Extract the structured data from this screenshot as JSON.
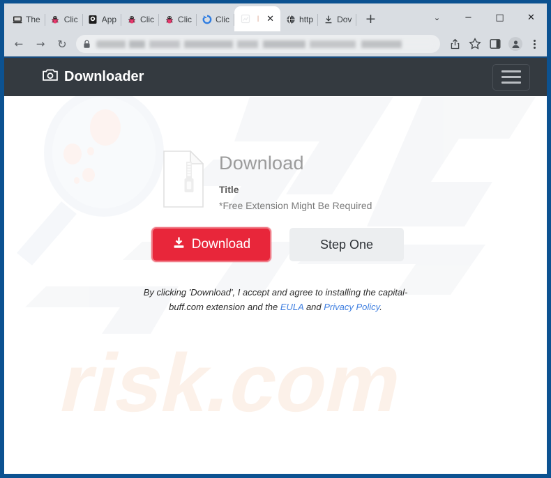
{
  "browser": {
    "tabs": [
      {
        "label": "The",
        "icon": "computer-icon",
        "active": false
      },
      {
        "label": "Clic",
        "icon": "bug-icon",
        "active": false
      },
      {
        "label": "App",
        "icon": "monitor-icon",
        "active": false
      },
      {
        "label": "Clic",
        "icon": "bug-icon",
        "active": false
      },
      {
        "label": "Clic",
        "icon": "bug-icon",
        "active": false
      },
      {
        "label": "Clic",
        "icon": "refresh-icon",
        "active": false
      },
      {
        "label": "I",
        "icon": "blank-page-icon",
        "active": true
      },
      {
        "label": "http",
        "icon": "globe-icon",
        "active": false
      },
      {
        "label": "Dov",
        "icon": "download-icon",
        "active": false
      }
    ],
    "new_tab_label": "+",
    "tab_close_label": "✕",
    "window_controls": {
      "tab_search": "⌄",
      "minimize": "−",
      "maximize": "□",
      "close": "✕"
    },
    "nav": {
      "back": "←",
      "forward": "→",
      "reload": "↻"
    },
    "omnibox": {
      "value": "",
      "placeholder": "",
      "security_icon": "lock-icon"
    },
    "toolbar_icons": [
      "share-icon",
      "bookmark-star-icon",
      "side-panel-icon",
      "profile-avatar-icon",
      "three-dot-menu-icon"
    ]
  },
  "page": {
    "header": {
      "brand": "Downloader",
      "brand_icon": "camera-icon",
      "menu_icon": "hamburger-icon"
    },
    "download_card": {
      "file_icon": "zip-file-icon",
      "heading": "Download",
      "subtitle": "Title",
      "note": "*Free Extension Might Be Required"
    },
    "buttons": {
      "download": "Download",
      "download_icon": "download-icon",
      "step_one": "Step One"
    },
    "legal": {
      "part1": "By clicking 'Download', I accept and agree to installing the capital-buff.com extension and the ",
      "link_eula": "EULA",
      "part2": " and ",
      "link_privacy": "Privacy Policy",
      "part3": "."
    },
    "watermark": {
      "logo": "pcrisk-magnifier-logo",
      "text_top": "PC",
      "text_bottom": "risk.com"
    }
  },
  "colors": {
    "window_frame": "#0c5291",
    "chrome_bg": "#d9dde2",
    "site_header": "#343a40",
    "accent_red": "#e8263a",
    "link_blue": "#3f7fe0",
    "step_button_bg": "#eceef0",
    "watermark_peach": "#fdeee4"
  }
}
